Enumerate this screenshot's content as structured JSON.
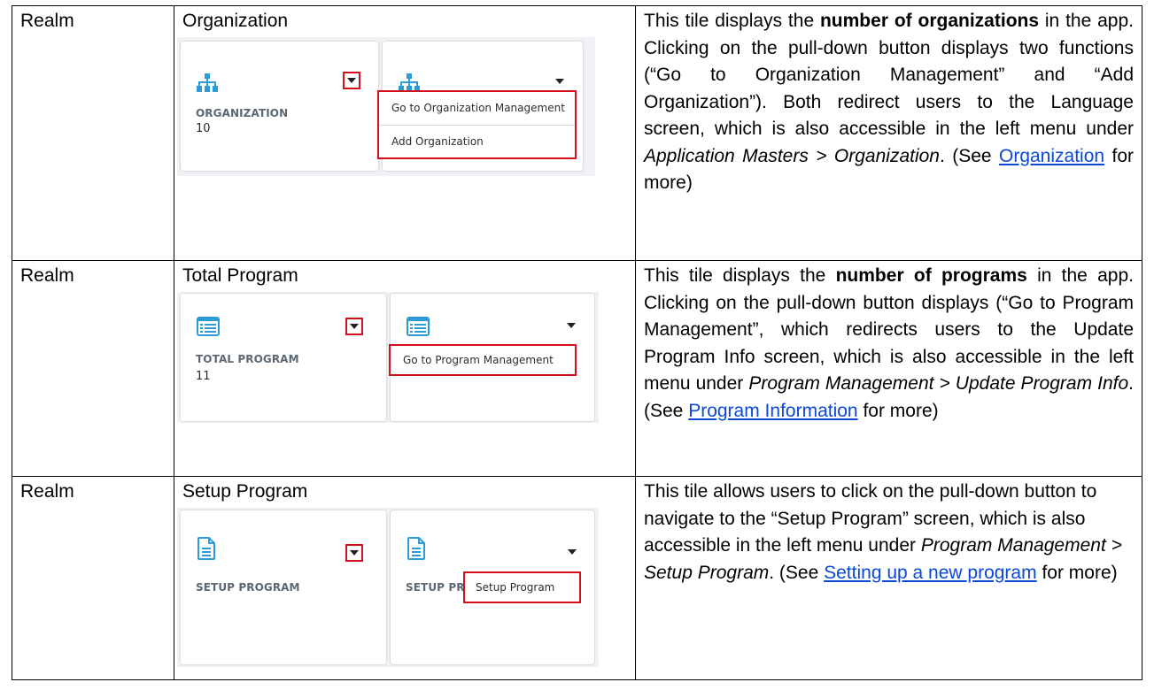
{
  "rows": [
    {
      "col1": "Realm",
      "col2_title": "Organization",
      "tile_label": "ORGANIZATION",
      "tile_count": "10",
      "menu_items": [
        "Go to Organization Management",
        "Add Organization"
      ],
      "desc": {
        "p1": "This tile displays the ",
        "b1": "number of organizations",
        "p2": " in the app. Clicking on the pull-down button displays two functions (“Go to Organization Management” and “Add Organization”). Both redirect users to the Language screen, which is also accessible in the left menu under ",
        "i1": "Application Masters > Organization",
        "p3": ". (See ",
        "link": "Organization",
        "p4": " for more)"
      }
    },
    {
      "col1": "Realm",
      "col2_title": "Total Program",
      "tile_label": "TOTAL PROGRAM",
      "tile_count": "11",
      "menu_items": [
        "Go to Program Management"
      ],
      "desc": {
        "p1": "This tile displays the ",
        "b1": "number of programs",
        "p2": " in the app. Clicking on the pull-down button displays (“Go to Program Management”, which redirects users to the Update Program Info screen, which is also accessible in the left menu under ",
        "i1": "Program Management > Update Program Info",
        "p3": ". (See ",
        "link": "Program Information",
        "p4": " for more)"
      }
    },
    {
      "col1": "Realm",
      "col2_title": "Setup Program",
      "tile_label": "SETUP PROGRAM",
      "tile_label_cut": "SETUP PR",
      "menu_items": [
        "Setup Program"
      ],
      "desc": {
        "p1": "This tile allows users to click on the pull-down button to navigate to the “Setup Program” screen, which is also accessible in the left menu under ",
        "i1": "Program Management > Setup Program",
        "p3": ". (See ",
        "link": "Setting up a new program",
        "p4": " for more)"
      }
    }
  ],
  "colors": {
    "icon_blue": "#2d9bd6",
    "highlight_red": "#d0101a",
    "link_blue": "#0b48d8"
  }
}
